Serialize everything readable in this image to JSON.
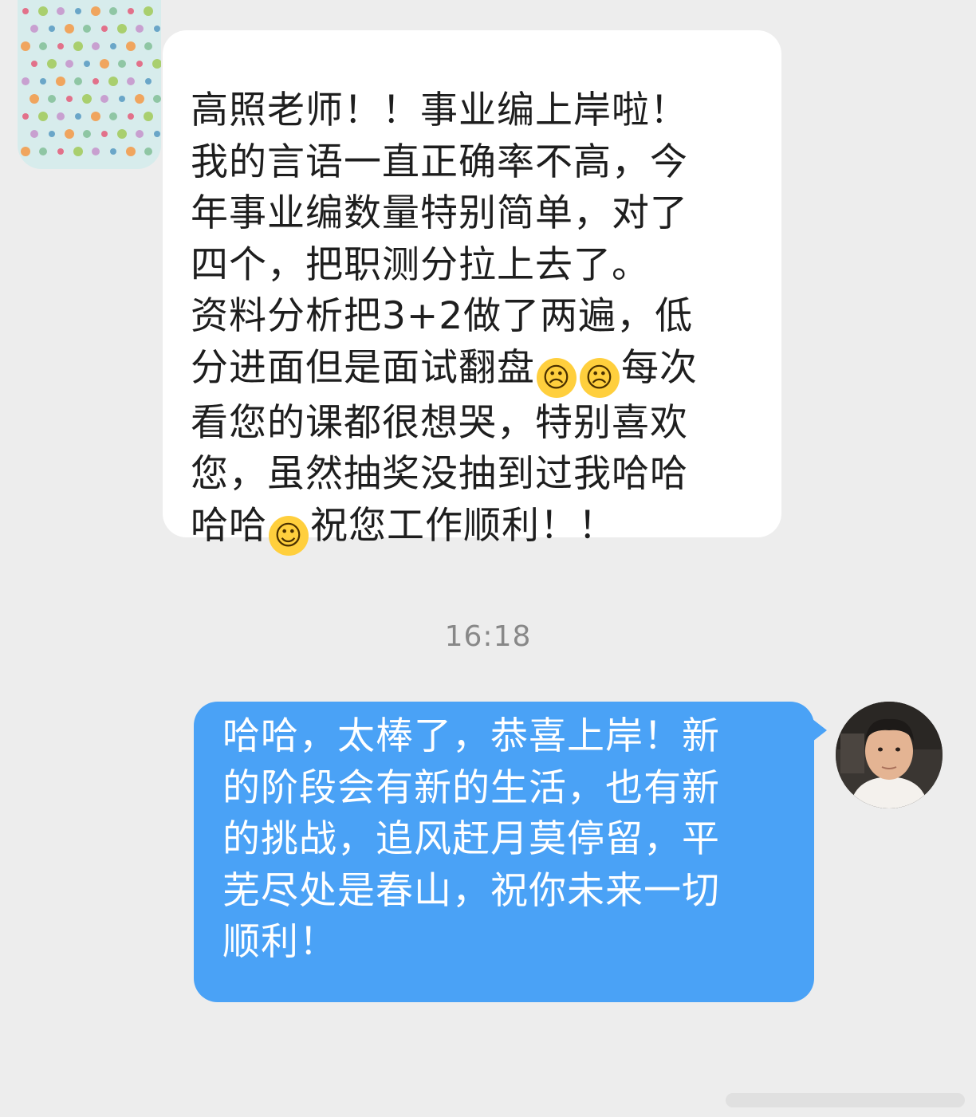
{
  "incoming_message": {
    "lines": [
      "高照老师！！事业编上岸啦！",
      "我的言语一直正确率不高，今",
      "年事业编数量特别简单，对了",
      "四个，把职测分拉上去了。",
      "资料分析把3+2做了两遍，低",
      "分进面但是面试翻盘",
      "每次",
      "看您的课都很想哭，特别喜欢",
      "您，虽然抽奖没抽到过我哈哈",
      "哈哈",
      "祝您工作顺利！！"
    ],
    "emojis": [
      "loudly-crying-face",
      "loudly-crying-face",
      "grinning-face"
    ]
  },
  "timestamp": "16:18",
  "outgoing_message": {
    "lines": [
      "哈哈，太棒了，恭喜上岸！新",
      "的阶段会有新的生活，也有新",
      "的挑战，追风赶月莫停留，平",
      "芜尽处是春山，祝你未来一切",
      "顺利！"
    ]
  },
  "colors": {
    "background": "#ededed",
    "incoming_bubble": "#ffffff",
    "outgoing_bubble": "#4aa2f6",
    "timestamp_text": "#888888"
  }
}
